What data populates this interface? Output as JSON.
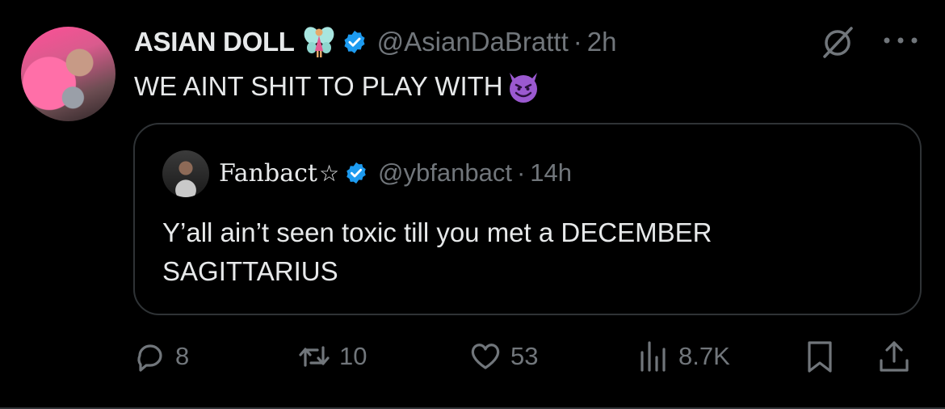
{
  "author": {
    "display_name": "ASIAN DOLL",
    "handle": "@AsianDaBrattt",
    "separator": "·",
    "time": "2h"
  },
  "tweet": {
    "text": "WE AINT SHIT TO PLAY WITH"
  },
  "quoted": {
    "display_name": "Fanbact",
    "star": "☆",
    "handle": "@ybfanbact",
    "separator": "·",
    "time": "14h",
    "text": "Y’all ain’t seen toxic till you met a DECEMBER SAGITTARIUS"
  },
  "actions": {
    "replies": "8",
    "reposts": "10",
    "likes": "53",
    "views": "8.7K"
  },
  "colors": {
    "background": "#000000",
    "text": "#e7e9ea",
    "muted": "#71767b",
    "verified": "#1d9bf0",
    "border": "#2f3336"
  },
  "icons": [
    "fairy-emoji-icon",
    "verified-badge-icon",
    "grok-icon",
    "more-icon",
    "smiling-devil-emoji-icon",
    "reply-icon",
    "repost-icon",
    "like-icon",
    "views-icon",
    "bookmark-icon",
    "share-icon"
  ]
}
